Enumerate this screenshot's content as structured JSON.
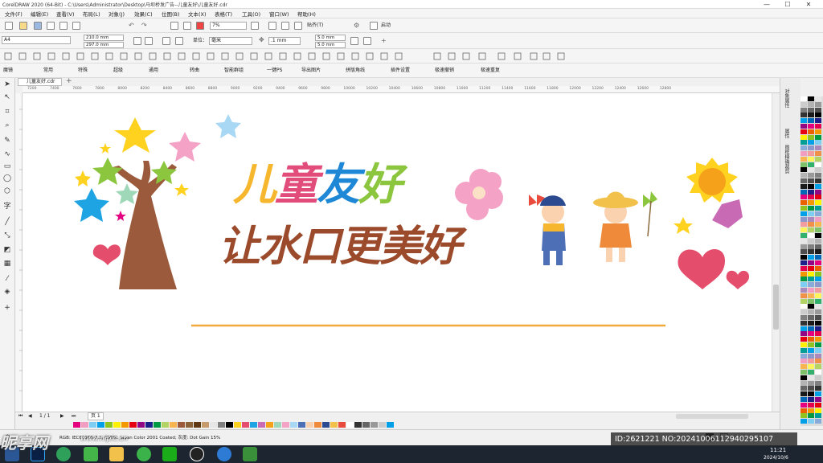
{
  "titlebar": {
    "title": "CorelDRAW 2020 (64-Bit) - C:\\Users\\Administrator\\Desktop\\马坝桥发广告--儿童友好\\儿童友好.cdr",
    "minimize": "—",
    "maximize": "☐",
    "close": "✕"
  },
  "menu": [
    "文件(F)",
    "编辑(E)",
    "查看(V)",
    "布局(L)",
    "对象(J)",
    "效果(C)",
    "位图(B)",
    "文本(X)",
    "表格(T)",
    "工具(O)",
    "窗口(W)",
    "帮助(H)"
  ],
  "standard_toolbar": {
    "zoom": "7%",
    "snap": "贴齐(T)",
    "launch": "启动"
  },
  "property_bar": {
    "page_size": "A4",
    "width": "210.0 mm",
    "height": "297.0 mm",
    "units_label": "单位：",
    "units_value": "毫米",
    "nudge": ".1 mm",
    "dup_x": "5.0 mm",
    "dup_y": "5.0 mm"
  },
  "plugin_bar": [
    "魔镜",
    "常用",
    "特殊",
    "超级",
    "通用",
    "转曲",
    "智能群组",
    "一键PS",
    "导出图片",
    "拼版角线",
    "插件设置",
    "极速撤销",
    "极速重复"
  ],
  "document_tab": "儿童友好.cdr",
  "ruler_ticks": [
    "7200",
    "7400",
    "7600",
    "7800",
    "8000",
    "8200",
    "8400",
    "8600",
    "8800",
    "9000",
    "9200",
    "9400",
    "9600",
    "9800",
    "10000",
    "10200",
    "10400",
    "10600",
    "10800",
    "11000",
    "11200",
    "11400",
    "11600",
    "11800",
    "12000",
    "12200",
    "12400",
    "12600",
    "12800"
  ],
  "artwork": {
    "heading_chars": [
      "儿",
      "童",
      "友",
      "好"
    ],
    "heading_colors": [
      "#f6b62d",
      "#e24c7a",
      "#1f88d6",
      "#8cc63f"
    ],
    "subheading": "让水口更美好",
    "subheading_color": "#9b4a2b",
    "line_color": "#f2a93b"
  },
  "right_dock_tabs": [
    "对象属性",
    "属性",
    "图框精确裁剪"
  ],
  "page_bar": {
    "counter": "1 / 1",
    "page_label": "页 1"
  },
  "status": {
    "color_profile": "RGB: IEC61966-2.1; CMYK: Japan Color 2001 Coated; 灰度: Dot Gain 15%"
  },
  "watermark": {
    "brand": "昵享网",
    "url": "www.nipic.cn"
  },
  "id_banner": "ID:2621221 NO:20241006112940295107",
  "clock": {
    "time": "11:21",
    "date": "2024/10/6"
  },
  "colors": {
    "accent": "#2e7bd6",
    "taskbar": "#1d2530"
  }
}
